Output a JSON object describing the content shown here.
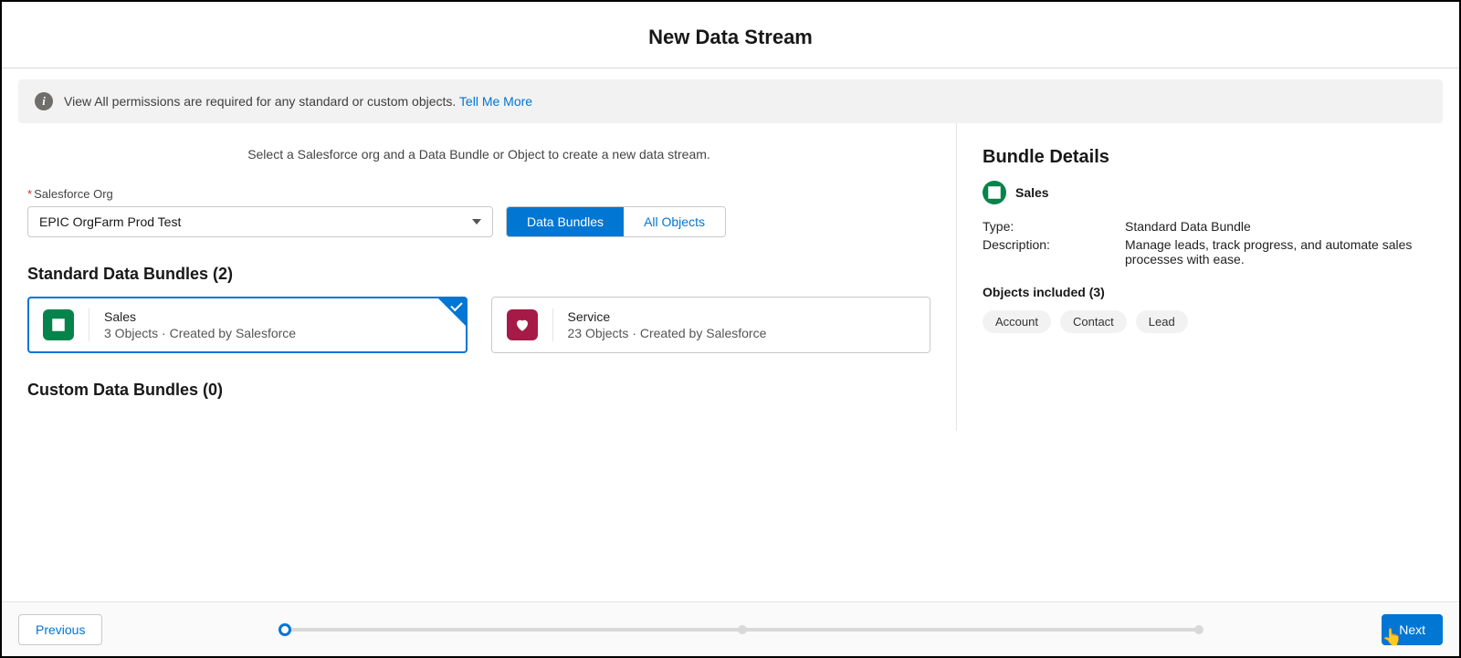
{
  "header": {
    "title": "New Data Stream"
  },
  "info": {
    "text": "View All permissions are required for any standard or custom objects.",
    "link": "Tell Me More"
  },
  "intro": "Select a Salesforce org and a Data Bundle or Object to create a new data stream.",
  "orgField": {
    "label": "Salesforce Org",
    "value": "EPIC OrgFarm Prod Test"
  },
  "toggle": {
    "dataBundles": "Data Bundles",
    "allObjects": "All Objects"
  },
  "standardBundles": {
    "title": "Standard Data Bundles (2)",
    "items": [
      {
        "name": "Sales",
        "sub": "3 Objects · Created by Salesforce"
      },
      {
        "name": "Service",
        "sub": "23 Objects · Created by Salesforce"
      }
    ]
  },
  "customBundles": {
    "title": "Custom Data Bundles (0)"
  },
  "details": {
    "title": "Bundle Details",
    "name": "Sales",
    "typeLabel": "Type:",
    "typeValue": "Standard Data Bundle",
    "descLabel": "Description:",
    "descValue": "Manage leads, track progress, and automate sales processes with ease.",
    "objectsTitle": "Objects included (3)",
    "chips": [
      "Account",
      "Contact",
      "Lead"
    ]
  },
  "footer": {
    "previous": "Previous",
    "next": "Next"
  }
}
